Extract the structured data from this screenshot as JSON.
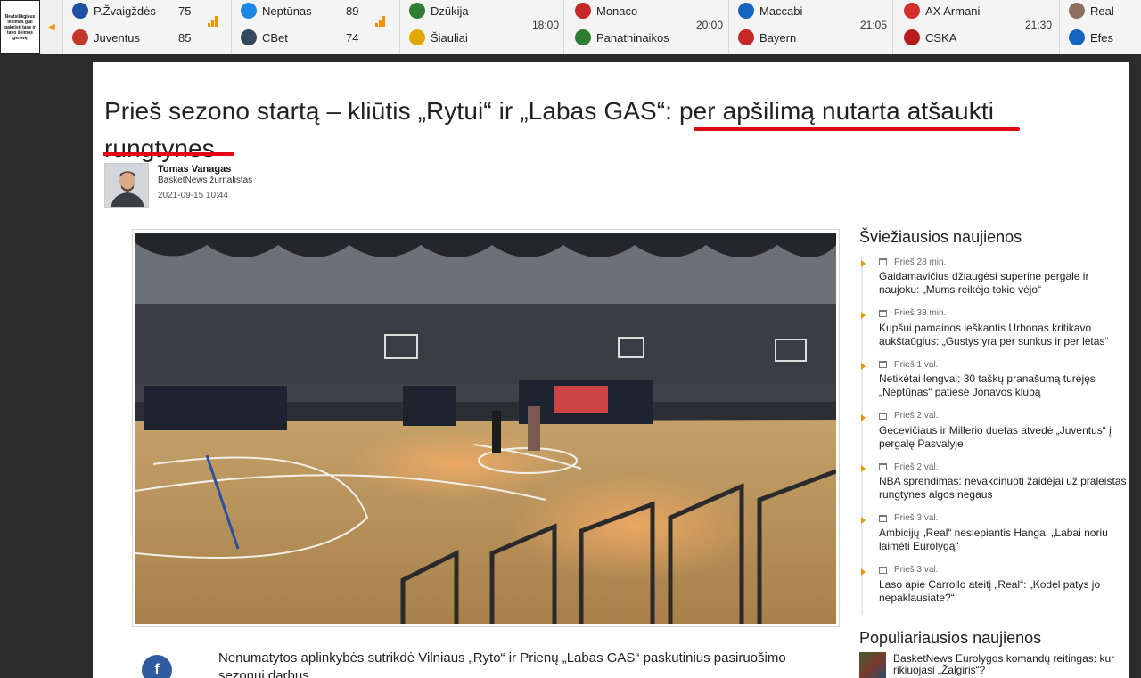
{
  "ticker": {
    "promo_text": "Neatsilikgiaus lesimas gali pakeisti tave ir tavo šeimos gerovę",
    "matches": [
      {
        "team1": "P.Žvaigždės",
        "team2": "Juventus",
        "score1": "75",
        "score2": "85",
        "time": "",
        "color1": "#1f4fa3",
        "color2": "#c0392b"
      },
      {
        "team1": "Neptūnas",
        "team2": "CBet",
        "score1": "89",
        "score2": "74",
        "time": "",
        "color1": "#1e88e5",
        "color2": "#34495e"
      },
      {
        "team1": "Dzūkija",
        "team2": "Šiauliai",
        "score1": "",
        "score2": "",
        "time": "18:00",
        "color1": "#2e7d32",
        "color2": "#e0a800"
      },
      {
        "team1": "Monaco",
        "team2": "Panathinaikos",
        "score1": "",
        "score2": "",
        "time": "20:00",
        "color1": "#c62828",
        "color2": "#2e7d32"
      },
      {
        "team1": "Maccabi",
        "team2": "Bayern",
        "score1": "",
        "score2": "",
        "time": "21:05",
        "color1": "#1565c0",
        "color2": "#c62828"
      },
      {
        "team1": "AX Armani",
        "team2": "CSKA",
        "score1": "",
        "score2": "",
        "time": "21:30",
        "color1": "#d32f2f",
        "color2": "#b71c1c"
      },
      {
        "team1": "Real",
        "team2": "Efes",
        "score1": "",
        "score2": "",
        "time": "",
        "color1": "#8d6e63",
        "color2": "#1565c0"
      }
    ]
  },
  "article": {
    "title": "Prieš sezono startą – kliūtis „Rytui“ ir „Labas GAS“: per apšilimą nutarta atšaukti rungtynes",
    "author_name": "Tomas Vanagas",
    "author_role": "BasketNews žurnalistas",
    "date": "2021-09-15 10:44",
    "lead": "Nenumatytos aplinkybės sutrikdė Vilniaus „Ryto“ ir Prienų „Labas GAS“ paskutinius pasiruošimo sezonui darbus."
  },
  "sidebar": {
    "fresh_title": "Šviežiausios naujienos",
    "fresh_items": [
      {
        "time": "Prieš 28 min.",
        "title": "Gaidamavičius džiaugėsi superine pergale ir naujoku: „Mums reikėjo tokio vėjo“"
      },
      {
        "time": "Prieš 38 min.",
        "title": "Kupšui pamainos ieškantis Urbonas kritikavo aukštaūgius: „Gustys yra per sunkus ir per lėtas“"
      },
      {
        "time": "Prieš 1 val.",
        "title": "Netikėtai lengvai: 30 taškų pranašumą turėjęs „Neptūnas“ patiesė Jonavos klubą"
      },
      {
        "time": "Prieš 2 val.",
        "title": "Gecevičiaus ir Millerio duetas atvedė „Juventus“ į pergalę Pasvalyje"
      },
      {
        "time": "Prieš 2 val.",
        "title": "NBA sprendimas: nevakcinuoti žaidėjai už praleistas rungtynes algos negaus"
      },
      {
        "time": "Prieš 3 val.",
        "title": "Ambicijų „Real“ neslepiantis Hanga: „Labai noriu laimėti Eurolygą“"
      },
      {
        "time": "Prieš 3 val.",
        "title": "Laso apie Carrollo ateitį „Real“: „Kodėl patys jo nepaklausiate?“"
      }
    ],
    "popular_title": "Populiariausios naujienos",
    "popular_items": [
      {
        "title": "BasketNews Eurolygos komandų reitingas: kur rikiuojasi „Žalgiris“?"
      }
    ]
  },
  "share": {
    "facebook_glyph": "f"
  },
  "colors": {
    "accent": "#f39200",
    "underline": "#e30613",
    "facebook": "#2e5b9e"
  }
}
